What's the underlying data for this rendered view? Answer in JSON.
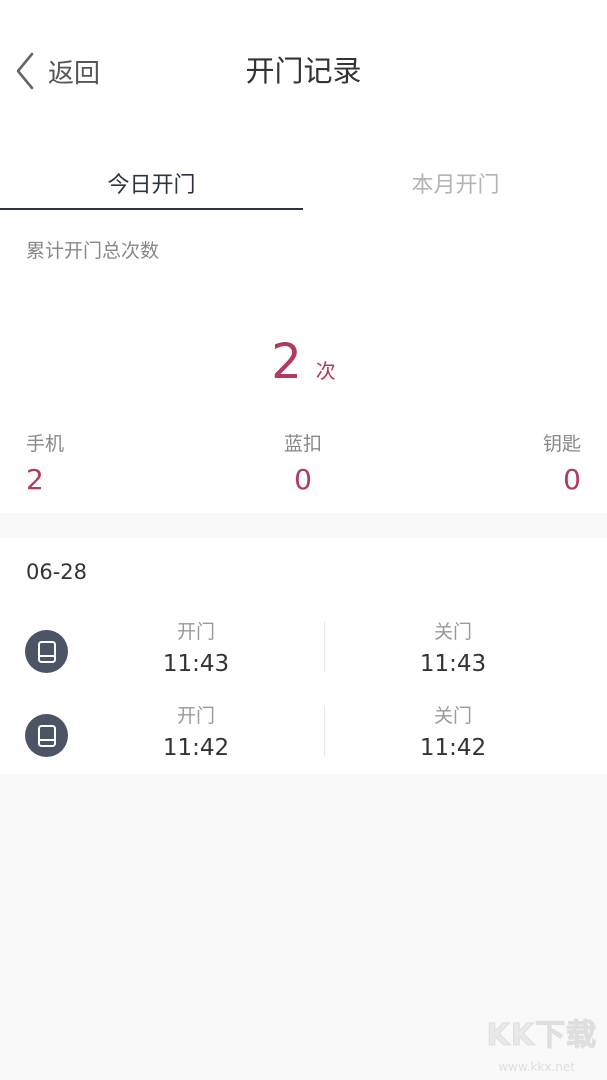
{
  "header": {
    "back_label": "返回",
    "title": "开门记录"
  },
  "tabs": [
    {
      "label": "今日开门",
      "active": true
    },
    {
      "label": "本月开门",
      "active": false
    }
  ],
  "summary": {
    "label": "累计开门总次数",
    "count": "2",
    "unit": "次"
  },
  "stats": [
    {
      "label": "手机",
      "value": "2"
    },
    {
      "label": "蓝扣",
      "value": "0"
    },
    {
      "label": "钥匙",
      "value": "0"
    }
  ],
  "records": {
    "date": "06-28",
    "rows": [
      {
        "icon": "phone-device-icon",
        "open_label": "开门",
        "open_time": "11:43",
        "close_label": "关门",
        "close_time": "11:43"
      },
      {
        "icon": "phone-device-icon",
        "open_label": "开门",
        "open_time": "11:42",
        "close_label": "关门",
        "close_time": "11:42"
      }
    ]
  },
  "watermark": {
    "text": "KK下载",
    "url": "www.kkx.net"
  },
  "colors": {
    "accent": "#b23a5a",
    "tab_active": "#2c3444",
    "icon_bg": "#4c5566"
  }
}
